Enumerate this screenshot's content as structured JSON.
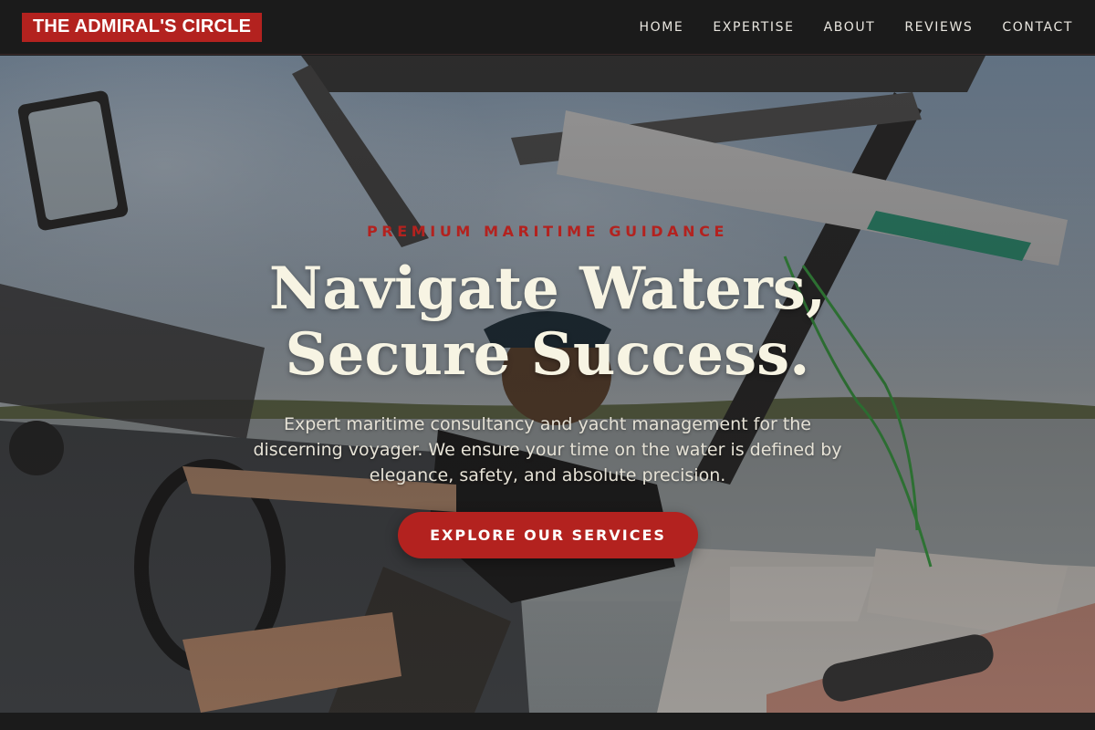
{
  "header": {
    "logo_text": "THE ADMIRAL'S CIRCLE",
    "nav": [
      {
        "label": "HOME"
      },
      {
        "label": "EXPERTISE"
      },
      {
        "label": "ABOUT"
      },
      {
        "label": "REVIEWS"
      },
      {
        "label": "CONTACT"
      }
    ]
  },
  "hero": {
    "eyebrow": "PREMIUM MARITIME GUIDANCE",
    "headline_line1": "Navigate Waters,",
    "headline_line2": "Secure Success.",
    "description": "Expert maritime consultancy and yacht management for the discerning voyager. We ensure your time on the water is defined by elegance, safety, and absolute precision.",
    "cta_label": "EXPLORE OUR SERVICES"
  },
  "colors": {
    "accent": "#b3221f",
    "header_bg": "#1b1b1b",
    "headline": "#f7f4e3"
  }
}
